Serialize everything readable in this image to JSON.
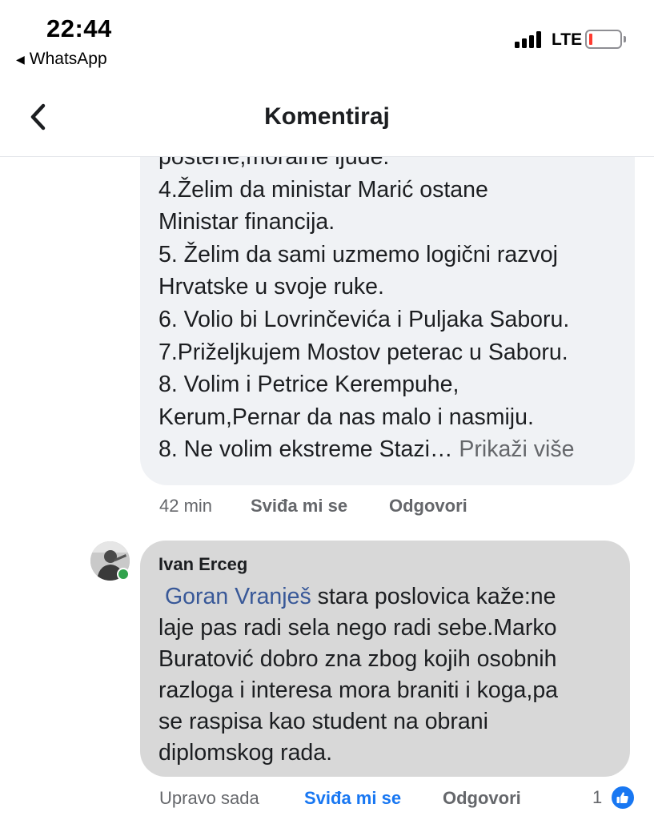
{
  "status_bar": {
    "time": "22:44",
    "back_app": "WhatsApp",
    "network": "LTE",
    "battery_level": 0.1
  },
  "header": {
    "title": "Komentiraj"
  },
  "comment1": {
    "lines": [
      "poštene,moralne ljude.",
      "4.Želim da ministar Marić ostane",
      "Ministar financija.",
      "5. Želim da sami uzmemo logični razvoj",
      "Hrvatske u svoje ruke.",
      "6. Volio bi Lovrinčevića i Puljaka Saboru.",
      "7.Priželjkujem Mostov peterac u Saboru.",
      "8. Volim i Petrice Kerempuhe,",
      "Kerum,Pernar da nas malo i nasmiju.",
      "8. Ne volim ekstreme Stazi…"
    ],
    "show_more": "Prikaži više",
    "time": "42 min",
    "like": "Sviđa mi se",
    "reply": "Odgovori"
  },
  "comment2": {
    "author": "Ivan Erceg",
    "mention": "Goran Vranješ",
    "lines": [
      "stara poslovica kaže:ne",
      "laje pas radi sela nego radi sebe.Marko",
      "Buratović dobro zna zbog kojih osobnih",
      "razloga i interesa mora braniti i koga,pa",
      "se raspisa kao student na obrani",
      "diplomskog rada."
    ],
    "time": "Upravo sada",
    "like": "Sviđa mi se",
    "reply": "Odgovori",
    "like_count": "1"
  },
  "colors": {
    "bubble": "#f0f2f5",
    "bubble_selected": "#d8d8d8",
    "meta": "#65676b",
    "accent": "#1877f2",
    "mention": "#385898",
    "online": "#31a24c"
  }
}
